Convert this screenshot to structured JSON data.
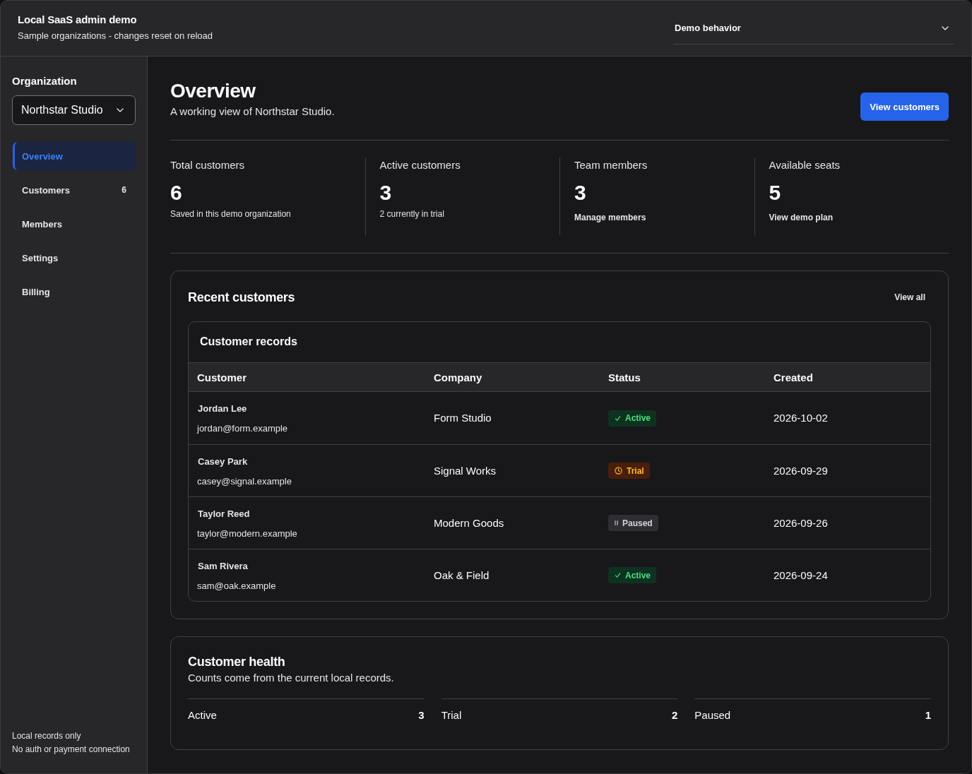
{
  "app": {
    "title": "Local SaaS admin demo",
    "subtitle": "Sample organizations - changes reset on reload"
  },
  "demo_select": {
    "value": "Demo behavior"
  },
  "sidebar": {
    "org_label": "Organization",
    "org_select": {
      "value": "Northstar Studio"
    },
    "items": [
      {
        "label": "Overview",
        "selected": true
      },
      {
        "label": "Customers",
        "count": "6",
        "selected": false
      },
      {
        "label": "Members",
        "selected": false
      },
      {
        "label": "Settings",
        "selected": false
      },
      {
        "label": "Billing",
        "selected": false
      }
    ],
    "footer": [
      "Local records only",
      "No auth or payment connection"
    ]
  },
  "page": {
    "title": "Overview",
    "subtitle": "A working view of Northstar Studio.",
    "action": "View customers"
  },
  "stats": [
    {
      "label": "Total customers",
      "value": "6",
      "note": {
        "kind": "text",
        "text": "Saved in this demo organization"
      }
    },
    {
      "label": "Active customers",
      "value": "3",
      "note": {
        "kind": "text",
        "text": "2 currently in trial"
      }
    },
    {
      "label": "Team members",
      "value": "3",
      "note": {
        "kind": "link",
        "text": "Manage members"
      }
    },
    {
      "label": "Available seats",
      "value": "5",
      "note": {
        "kind": "link",
        "text": "View demo plan"
      }
    }
  ],
  "recent": {
    "title": "Recent customers",
    "link": "View all",
    "table": {
      "title": "Customer records",
      "columns": [
        "Customer",
        "Company",
        "Status",
        "Created"
      ],
      "rows": [
        {
          "name": "Jordan Lee",
          "email": "jordan@form.example",
          "company": "Form Studio",
          "status": {
            "kind": "active",
            "label": "Active"
          },
          "created": "2026-10-02"
        },
        {
          "name": "Casey Park",
          "email": "casey@signal.example",
          "company": "Signal Works",
          "status": {
            "kind": "trial",
            "label": "Trial"
          },
          "created": "2026-09-29"
        },
        {
          "name": "Taylor Reed",
          "email": "taylor@modern.example",
          "company": "Modern Goods",
          "status": {
            "kind": "paused",
            "label": "Paused"
          },
          "created": "2026-09-26"
        },
        {
          "name": "Sam Rivera",
          "email": "sam@oak.example",
          "company": "Oak & Field",
          "status": {
            "kind": "active",
            "label": "Active"
          },
          "created": "2026-09-24"
        }
      ]
    }
  },
  "health": {
    "title": "Customer health",
    "subtitle": "Counts come from the current local records.",
    "items": [
      {
        "label": "Active",
        "count": "3"
      },
      {
        "label": "Trial",
        "count": "2"
      },
      {
        "label": "Paused",
        "count": "1"
      }
    ]
  }
}
